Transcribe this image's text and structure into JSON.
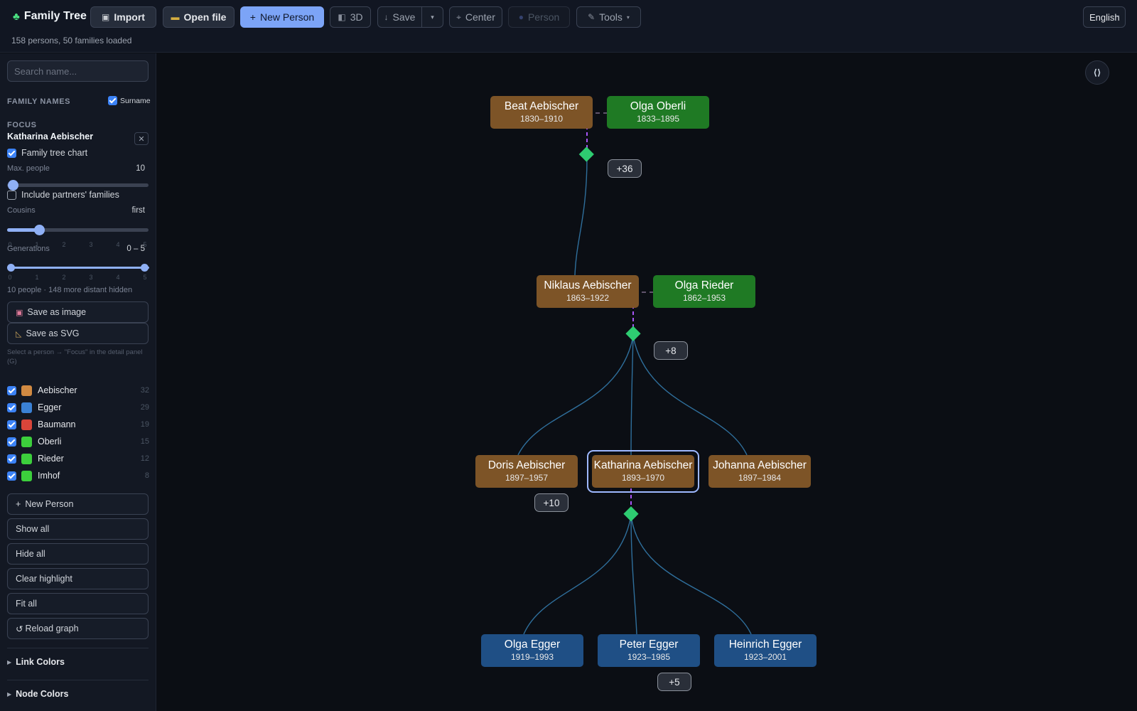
{
  "app": {
    "title": "Family Tree",
    "status": "158 persons, 50 families loaded"
  },
  "toolbar": {
    "import": "Import",
    "open_file": "Open file",
    "new_person": "New Person",
    "view_3d": "3D",
    "save": "Save",
    "save_menu": "▾",
    "center": "Center",
    "person": "Person",
    "tools": "Tools",
    "language": "English"
  },
  "sidebar": {
    "search_placeholder": "Search name...",
    "family_names_label": "FAMILY NAMES",
    "surname_toggle": "Surname",
    "focus_label": "FOCUS",
    "focus_person": "Katharina Aebischer",
    "family_tree_chart": "Family tree chart",
    "max_people_label": "Max. people",
    "max_people_value": "10",
    "include_partners": "Include partners' families",
    "cousins_label": "Cousins",
    "cousins_value": "first",
    "generations_label": "Generations",
    "generations_value": "0 – 5",
    "ticks": [
      "0",
      "1",
      "2",
      "3",
      "4",
      "5"
    ],
    "visibility_summary": "10 people · 148 more distant hidden",
    "save_image": "Save as image",
    "save_svg": "Save as SVG",
    "hint": "Select a person → \"Focus\" in the detail panel (G)",
    "families": [
      {
        "name": "Aebischer",
        "count": "32",
        "color": "#d18a42"
      },
      {
        "name": "Egger",
        "count": "29",
        "color": "#3b82d6"
      },
      {
        "name": "Baumann",
        "count": "19",
        "color": "#d9453a"
      },
      {
        "name": "Oberli",
        "count": "15",
        "color": "#3ccf3c"
      },
      {
        "name": "Rieder",
        "count": "12",
        "color": "#3ccf3c"
      },
      {
        "name": "Imhof",
        "count": "8",
        "color": "#3ccf3c"
      }
    ],
    "buttons": {
      "new_person": "New Person",
      "show_all": "Show all",
      "hide_all": "Hide all",
      "clear_highlight": "Clear highlight",
      "fit_all": "Fit all",
      "reload_graph": "Reload graph"
    },
    "link_colors": "Link Colors",
    "node_colors": "Node Colors"
  },
  "canvas": {
    "fit_icon": "⟨⟩",
    "nodes": [
      {
        "id": "beat",
        "name": "Beat Aebischer",
        "dates": "1830–1910",
        "family": "Aebischer"
      },
      {
        "id": "olga_oberli",
        "name": "Olga Oberli",
        "dates": "1833–1895",
        "family": "Oberli"
      },
      {
        "id": "niklaus",
        "name": "Niklaus Aebischer",
        "dates": "1863–1922",
        "family": "Aebischer"
      },
      {
        "id": "olga_rieder",
        "name": "Olga Rieder",
        "dates": "1862–1953",
        "family": "Rieder"
      },
      {
        "id": "doris",
        "name": "Doris Aebischer",
        "dates": "1897–1957",
        "family": "Aebischer"
      },
      {
        "id": "katharina",
        "name": "Katharina Aebischer",
        "dates": "1893–1970",
        "family": "Aebischer",
        "focused": true
      },
      {
        "id": "johanna",
        "name": "Johanna Aebischer",
        "dates": "1897–1984",
        "family": "Aebischer"
      },
      {
        "id": "olga_egger",
        "name": "Olga Egger",
        "dates": "1919–1993",
        "family": "Egger"
      },
      {
        "id": "peter",
        "name": "Peter Egger",
        "dates": "1923–1985",
        "family": "Egger"
      },
      {
        "id": "heinrich",
        "name": "Heinrich Egger",
        "dates": "1923–2001",
        "family": "Egger"
      }
    ],
    "badges": [
      "+36",
      "+8",
      "+10",
      "+5"
    ]
  }
}
